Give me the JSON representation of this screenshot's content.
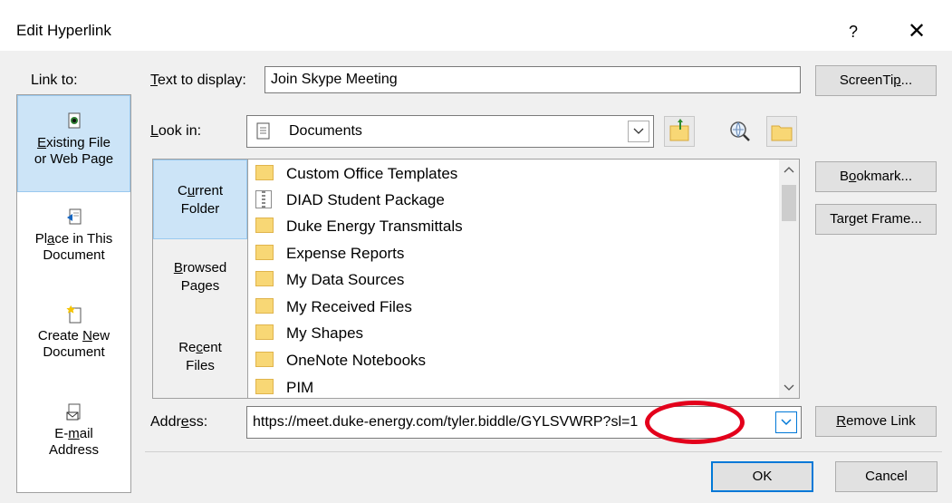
{
  "window": {
    "title": "Edit Hyperlink",
    "help_glyph": "?",
    "close_glyph": "✕"
  },
  "link_to": {
    "label": "Link to:",
    "items": [
      {
        "line1": "Existing File",
        "line1_ul": "E",
        "line1_rest": "xisting File",
        "line2": "or Web Page",
        "icon": "existing-file-icon",
        "selected": true
      },
      {
        "line1_pre": "Pl",
        "line1_ul": "a",
        "line1_rest": "ce in This",
        "line2": "Document",
        "icon": "place-in-document-icon"
      },
      {
        "line1_pre": "Create ",
        "line1_ul": "N",
        "line1_rest": "ew",
        "line2": "Document",
        "icon": "create-new-document-icon"
      },
      {
        "line1_pre": "E-",
        "line1_ul": "m",
        "line1_rest": "ail",
        "line2": "Address",
        "icon": "email-address-icon"
      }
    ]
  },
  "text_to_display": {
    "label_ul": "T",
    "label_rest": "ext to display:",
    "value": "Join Skype Meeting"
  },
  "screentip": {
    "pre": "ScreenTi",
    "ul": "p",
    "rest": "..."
  },
  "look_in": {
    "label_ul": "L",
    "label_rest": "ook in:",
    "value": "Documents",
    "icon": "documents-folder-icon"
  },
  "toolbar": {
    "up_folder_icon": "up-one-folder-icon",
    "browse_web_icon": "browse-web-icon",
    "browse_file_icon": "browse-file-icon"
  },
  "places": [
    {
      "pre": "C",
      "ul": "u",
      "rest": "rrent",
      "line2": "Folder",
      "selected": true
    },
    {
      "pre": "",
      "ul": "B",
      "rest": "rowsed",
      "line2": "Pages"
    },
    {
      "pre": "Re",
      "ul": "c",
      "rest": "ent",
      "line2": "Files"
    }
  ],
  "files": [
    {
      "name": "Custom Office Templates",
      "type": "folder"
    },
    {
      "name": "DIAD Student Package",
      "type": "zip"
    },
    {
      "name": "Duke Energy Transmittals",
      "type": "folder"
    },
    {
      "name": "Expense Reports",
      "type": "folder"
    },
    {
      "name": "My Data Sources",
      "type": "folder"
    },
    {
      "name": "My Received Files",
      "type": "folder"
    },
    {
      "name": "My Shapes",
      "type": "folder"
    },
    {
      "name": "OneNote Notebooks",
      "type": "folder"
    },
    {
      "name": "PIM",
      "type": "folder"
    }
  ],
  "right_buttons": {
    "bookmark": {
      "pre": "B",
      "ul": "o",
      "rest": "okmark..."
    },
    "target_frame": {
      "pre": "Tar",
      "ul": "g",
      "rest": "et Frame..."
    },
    "remove_link": {
      "pre": "",
      "ul": "R",
      "rest": "emove Link"
    }
  },
  "address": {
    "label_pre": "Addr",
    "label_ul": "e",
    "label_rest": "ss:",
    "value": "https://meet.duke-energy.com/tyler.biddle/GYLSVWRP?sl=1"
  },
  "footer": {
    "ok_label": "OK",
    "cancel_label": "Cancel"
  },
  "annotation": {
    "color": "#e3001b"
  }
}
